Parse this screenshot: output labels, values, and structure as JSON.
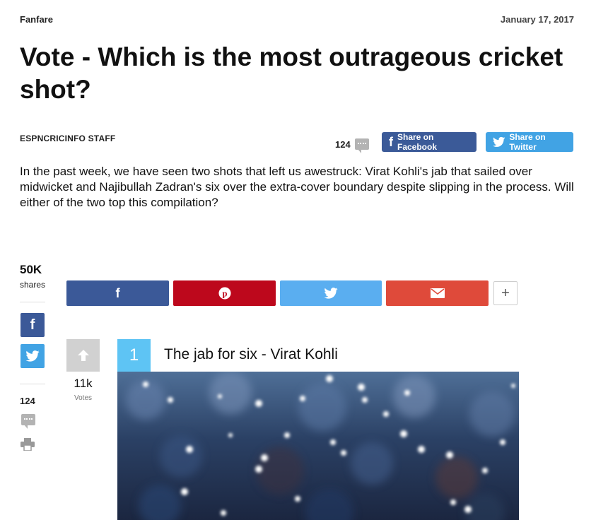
{
  "header": {
    "category": "Fanfare",
    "date": "January 17, 2017",
    "title": "Vote - Which is the most outrageous cricket shot?",
    "author": "ESPNCRICINFO STAFF"
  },
  "comments": {
    "count": "124",
    "icon": "comment-bubble-icon"
  },
  "share_buttons": {
    "facebook_label": "Share on Facebook",
    "twitter_label": "Share on Twitter"
  },
  "lead": "In the past week, we have seen two shots that left us awestruck: Virat Kohli's jab that sailed over midwicket and Najibullah Zadran's six over the extra-cover boundary despite slipping in the process. Will either of the two top this compilation?",
  "share_bar": {
    "count": "50K",
    "count_label": "shares",
    "more_label": "+",
    "colors": {
      "facebook": "#3b5998",
      "pinterest": "#bd081c",
      "twitter": "#5aaef0",
      "email": "#df4a3a"
    }
  },
  "sidebar": {
    "comment_count": "124"
  },
  "list_item": {
    "rank": "1",
    "title": "The jab for six - Virat Kohli",
    "votes": "11k",
    "votes_label": "Votes",
    "accent": "#5ec4f4"
  }
}
